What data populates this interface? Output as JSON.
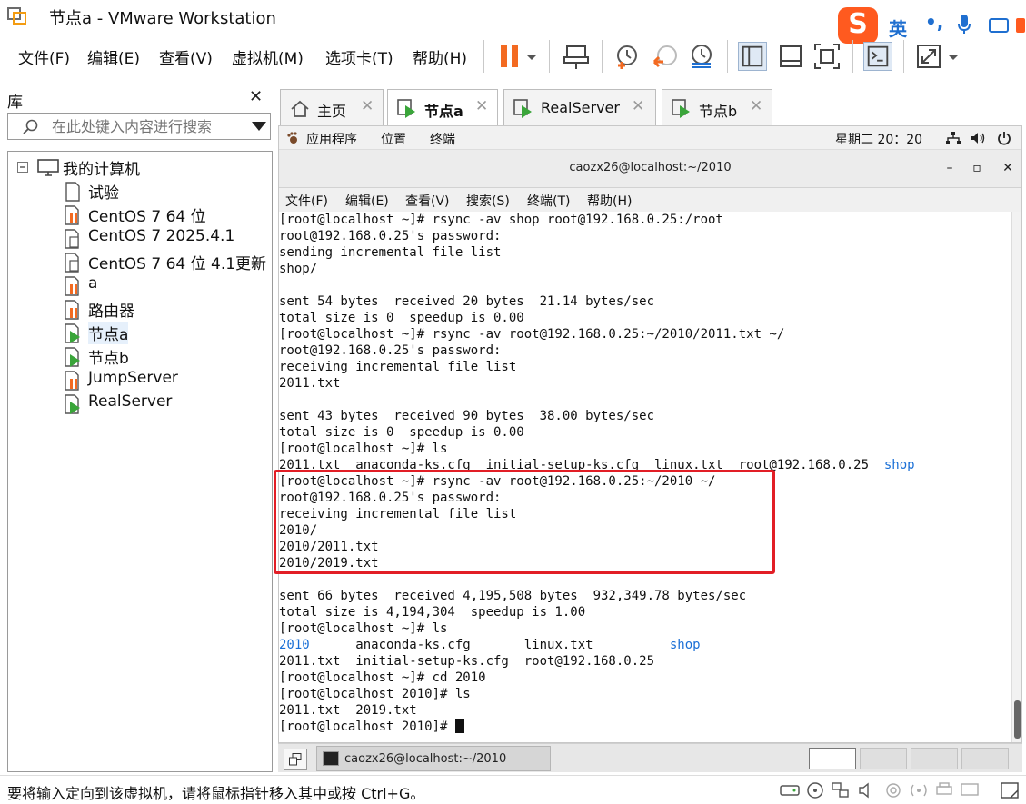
{
  "window": {
    "title": "节点a - VMware Workstation"
  },
  "ime": {
    "logo": "S",
    "lang": "英",
    "punct": "•,"
  },
  "menu": {
    "items": [
      "文件(F)",
      "编辑(E)",
      "查看(V)",
      "虚拟机(M)",
      "选项卡(T)",
      "帮助(H)"
    ]
  },
  "library": {
    "title": "库",
    "close": "✕",
    "search_placeholder": "在此处键入内容进行搜索",
    "root": "我的计算机",
    "vms": [
      {
        "label": "试验",
        "state": "doc"
      },
      {
        "label": "CentOS 7 64 位",
        "state": "paused"
      },
      {
        "label": "CentOS 7 2025.4.1",
        "state": "off"
      },
      {
        "label": "CentOS 7 64 位 4.1更新",
        "state": "off"
      },
      {
        "label": "a",
        "state": "paused"
      },
      {
        "label": "路由器",
        "state": "paused"
      },
      {
        "label": "节点a",
        "state": "running"
      },
      {
        "label": "节点b",
        "state": "running"
      },
      {
        "label": "JumpServer",
        "state": "paused"
      },
      {
        "label": "RealServer",
        "state": "running"
      }
    ]
  },
  "tabs": [
    {
      "label": "主页",
      "close": "✕"
    },
    {
      "label": "节点a",
      "close": "✕"
    },
    {
      "label": "RealServer",
      "close": "✕"
    },
    {
      "label": "节点b",
      "close": "✕"
    }
  ],
  "gnome": {
    "apps": "应用程序",
    "places": "位置",
    "terminal": "终端",
    "clock": "星期二 20：20"
  },
  "terminal": {
    "title": "caozx26@localhost:~/2010",
    "menu": [
      "文件(F)",
      "编辑(E)",
      "查看(V)",
      "搜索(S)",
      "终端(T)",
      "帮助(H)"
    ],
    "lines": [
      {
        "text": "[root@localhost ~]# rsync -av shop root@192.168.0.25:/root"
      },
      {
        "text": "root@192.168.0.25's password:"
      },
      {
        "text": "sending incremental file list"
      },
      {
        "text": "shop/"
      },
      {
        "text": ""
      },
      {
        "text": "sent 54 bytes  received 20 bytes  21.14 bytes/sec"
      },
      {
        "text": "total size is 0  speedup is 0.00"
      },
      {
        "text": "[root@localhost ~]# rsync -av root@192.168.0.25:~/2010/2011.txt ~/"
      },
      {
        "text": "root@192.168.0.25's password:"
      },
      {
        "text": "receiving incremental file list"
      },
      {
        "text": "2011.txt"
      },
      {
        "text": ""
      },
      {
        "text": "sent 43 bytes  received 90 bytes  38.00 bytes/sec"
      },
      {
        "text": "total size is 0  speedup is 0.00"
      },
      {
        "text": "[root@localhost ~]# ls"
      },
      {
        "text": "2011.txt  anaconda-ks.cfg  initial-setup-ks.cfg  linux.txt  root@192.168.0.25  ",
        "blue": "shop"
      },
      {
        "text": "[root@localhost ~]# rsync -av root@192.168.0.25:~/2010 ~/"
      },
      {
        "text": "root@192.168.0.25's password:"
      },
      {
        "text": "receiving incremental file list"
      },
      {
        "text": "2010/"
      },
      {
        "text": "2010/2011.txt"
      },
      {
        "text": "2010/2019.txt"
      },
      {
        "text": ""
      },
      {
        "text": "sent 66 bytes  received 4,195,508 bytes  932,349.78 bytes/sec"
      },
      {
        "text": "total size is 4,194,304  speedup is 1.00"
      },
      {
        "text": "[root@localhost ~]# ls"
      },
      {
        "blue_first": "2010",
        "text": "      anaconda-ks.cfg       linux.txt          ",
        "blue": "shop"
      },
      {
        "text": "2011.txt  initial-setup-ks.cfg  root@192.168.0.25"
      },
      {
        "text": "[root@localhost ~]# cd 2010"
      },
      {
        "text": "[root@localhost 2010]# ls"
      },
      {
        "text": "2011.txt  2019.txt"
      },
      {
        "text": "[root@localhost 2010]# ",
        "cursor": true
      }
    ]
  },
  "taskbar": {
    "task_label": "caozx26@localhost:~/2010"
  },
  "status": {
    "text": "要将输入定向到该虚拟机，请将鼠标指针移入其中或按 Ctrl+G。"
  }
}
